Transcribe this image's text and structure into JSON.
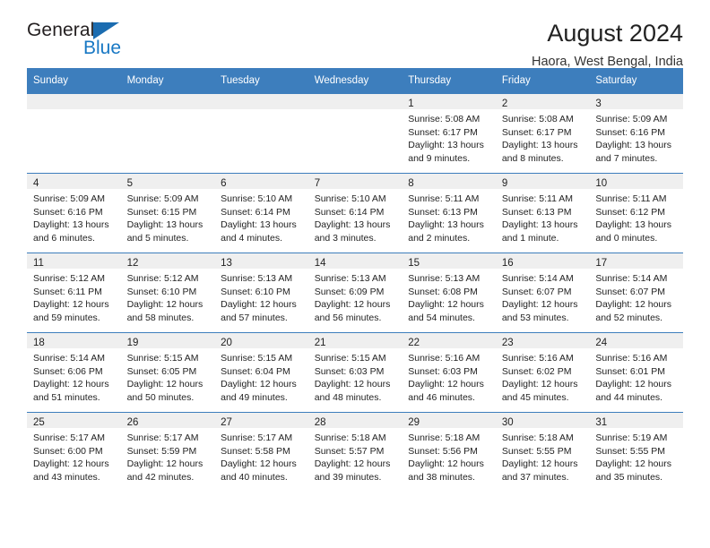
{
  "brand": {
    "name_top": "General",
    "name_bottom": "Blue",
    "accent_color": "#1878c4",
    "triangle_color": "#1b6cb0"
  },
  "header": {
    "title": "August 2024",
    "subtitle": "Haora, West Bengal, India"
  },
  "theme": {
    "header_bg": "#3d7ebd",
    "header_text": "#ffffff",
    "daynum_band_bg": "#efefef",
    "grid_line": "#3d7ebd",
    "cell_bg": "#ffffff",
    "body_text": "#232323"
  },
  "weekday_headers": [
    "Sunday",
    "Monday",
    "Tuesday",
    "Wednesday",
    "Thursday",
    "Friday",
    "Saturday"
  ],
  "labels": {
    "sunrise_prefix": "Sunrise:",
    "sunset_prefix": "Sunset:",
    "daylight_prefix": "Daylight:"
  },
  "weeks": [
    [
      {
        "day": "",
        "empty": true
      },
      {
        "day": "",
        "empty": true
      },
      {
        "day": "",
        "empty": true
      },
      {
        "day": "",
        "empty": true
      },
      {
        "day": "1",
        "sunrise": "Sunrise: 5:08 AM",
        "sunset": "Sunset: 6:17 PM",
        "daylight1": "Daylight: 13 hours",
        "daylight2": "and 9 minutes."
      },
      {
        "day": "2",
        "sunrise": "Sunrise: 5:08 AM",
        "sunset": "Sunset: 6:17 PM",
        "daylight1": "Daylight: 13 hours",
        "daylight2": "and 8 minutes."
      },
      {
        "day": "3",
        "sunrise": "Sunrise: 5:09 AM",
        "sunset": "Sunset: 6:16 PM",
        "daylight1": "Daylight: 13 hours",
        "daylight2": "and 7 minutes."
      }
    ],
    [
      {
        "day": "4",
        "sunrise": "Sunrise: 5:09 AM",
        "sunset": "Sunset: 6:16 PM",
        "daylight1": "Daylight: 13 hours",
        "daylight2": "and 6 minutes."
      },
      {
        "day": "5",
        "sunrise": "Sunrise: 5:09 AM",
        "sunset": "Sunset: 6:15 PM",
        "daylight1": "Daylight: 13 hours",
        "daylight2": "and 5 minutes."
      },
      {
        "day": "6",
        "sunrise": "Sunrise: 5:10 AM",
        "sunset": "Sunset: 6:14 PM",
        "daylight1": "Daylight: 13 hours",
        "daylight2": "and 4 minutes."
      },
      {
        "day": "7",
        "sunrise": "Sunrise: 5:10 AM",
        "sunset": "Sunset: 6:14 PM",
        "daylight1": "Daylight: 13 hours",
        "daylight2": "and 3 minutes."
      },
      {
        "day": "8",
        "sunrise": "Sunrise: 5:11 AM",
        "sunset": "Sunset: 6:13 PM",
        "daylight1": "Daylight: 13 hours",
        "daylight2": "and 2 minutes."
      },
      {
        "day": "9",
        "sunrise": "Sunrise: 5:11 AM",
        "sunset": "Sunset: 6:13 PM",
        "daylight1": "Daylight: 13 hours",
        "daylight2": "and 1 minute."
      },
      {
        "day": "10",
        "sunrise": "Sunrise: 5:11 AM",
        "sunset": "Sunset: 6:12 PM",
        "daylight1": "Daylight: 13 hours",
        "daylight2": "and 0 minutes."
      }
    ],
    [
      {
        "day": "11",
        "sunrise": "Sunrise: 5:12 AM",
        "sunset": "Sunset: 6:11 PM",
        "daylight1": "Daylight: 12 hours",
        "daylight2": "and 59 minutes."
      },
      {
        "day": "12",
        "sunrise": "Sunrise: 5:12 AM",
        "sunset": "Sunset: 6:10 PM",
        "daylight1": "Daylight: 12 hours",
        "daylight2": "and 58 minutes."
      },
      {
        "day": "13",
        "sunrise": "Sunrise: 5:13 AM",
        "sunset": "Sunset: 6:10 PM",
        "daylight1": "Daylight: 12 hours",
        "daylight2": "and 57 minutes."
      },
      {
        "day": "14",
        "sunrise": "Sunrise: 5:13 AM",
        "sunset": "Sunset: 6:09 PM",
        "daylight1": "Daylight: 12 hours",
        "daylight2": "and 56 minutes."
      },
      {
        "day": "15",
        "sunrise": "Sunrise: 5:13 AM",
        "sunset": "Sunset: 6:08 PM",
        "daylight1": "Daylight: 12 hours",
        "daylight2": "and 54 minutes."
      },
      {
        "day": "16",
        "sunrise": "Sunrise: 5:14 AM",
        "sunset": "Sunset: 6:07 PM",
        "daylight1": "Daylight: 12 hours",
        "daylight2": "and 53 minutes."
      },
      {
        "day": "17",
        "sunrise": "Sunrise: 5:14 AM",
        "sunset": "Sunset: 6:07 PM",
        "daylight1": "Daylight: 12 hours",
        "daylight2": "and 52 minutes."
      }
    ],
    [
      {
        "day": "18",
        "sunrise": "Sunrise: 5:14 AM",
        "sunset": "Sunset: 6:06 PM",
        "daylight1": "Daylight: 12 hours",
        "daylight2": "and 51 minutes."
      },
      {
        "day": "19",
        "sunrise": "Sunrise: 5:15 AM",
        "sunset": "Sunset: 6:05 PM",
        "daylight1": "Daylight: 12 hours",
        "daylight2": "and 50 minutes."
      },
      {
        "day": "20",
        "sunrise": "Sunrise: 5:15 AM",
        "sunset": "Sunset: 6:04 PM",
        "daylight1": "Daylight: 12 hours",
        "daylight2": "and 49 minutes."
      },
      {
        "day": "21",
        "sunrise": "Sunrise: 5:15 AM",
        "sunset": "Sunset: 6:03 PM",
        "daylight1": "Daylight: 12 hours",
        "daylight2": "and 48 minutes."
      },
      {
        "day": "22",
        "sunrise": "Sunrise: 5:16 AM",
        "sunset": "Sunset: 6:03 PM",
        "daylight1": "Daylight: 12 hours",
        "daylight2": "and 46 minutes."
      },
      {
        "day": "23",
        "sunrise": "Sunrise: 5:16 AM",
        "sunset": "Sunset: 6:02 PM",
        "daylight1": "Daylight: 12 hours",
        "daylight2": "and 45 minutes."
      },
      {
        "day": "24",
        "sunrise": "Sunrise: 5:16 AM",
        "sunset": "Sunset: 6:01 PM",
        "daylight1": "Daylight: 12 hours",
        "daylight2": "and 44 minutes."
      }
    ],
    [
      {
        "day": "25",
        "sunrise": "Sunrise: 5:17 AM",
        "sunset": "Sunset: 6:00 PM",
        "daylight1": "Daylight: 12 hours",
        "daylight2": "and 43 minutes."
      },
      {
        "day": "26",
        "sunrise": "Sunrise: 5:17 AM",
        "sunset": "Sunset: 5:59 PM",
        "daylight1": "Daylight: 12 hours",
        "daylight2": "and 42 minutes."
      },
      {
        "day": "27",
        "sunrise": "Sunrise: 5:17 AM",
        "sunset": "Sunset: 5:58 PM",
        "daylight1": "Daylight: 12 hours",
        "daylight2": "and 40 minutes."
      },
      {
        "day": "28",
        "sunrise": "Sunrise: 5:18 AM",
        "sunset": "Sunset: 5:57 PM",
        "daylight1": "Daylight: 12 hours",
        "daylight2": "and 39 minutes."
      },
      {
        "day": "29",
        "sunrise": "Sunrise: 5:18 AM",
        "sunset": "Sunset: 5:56 PM",
        "daylight1": "Daylight: 12 hours",
        "daylight2": "and 38 minutes."
      },
      {
        "day": "30",
        "sunrise": "Sunrise: 5:18 AM",
        "sunset": "Sunset: 5:55 PM",
        "daylight1": "Daylight: 12 hours",
        "daylight2": "and 37 minutes."
      },
      {
        "day": "31",
        "sunrise": "Sunrise: 5:19 AM",
        "sunset": "Sunset: 5:55 PM",
        "daylight1": "Daylight: 12 hours",
        "daylight2": "and 35 minutes."
      }
    ]
  ]
}
